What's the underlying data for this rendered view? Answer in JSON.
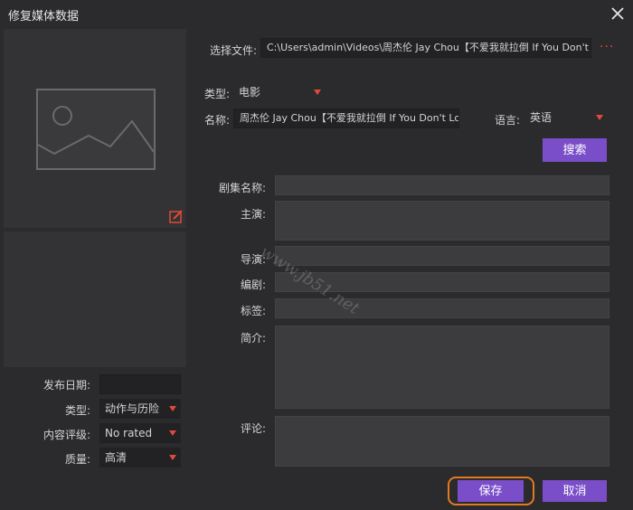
{
  "window": {
    "title": "修复媒体数据",
    "close_icon": "close-icon"
  },
  "poster": {
    "placeholder_icon": "image-placeholder-icon",
    "edit_icon": "edit-icon"
  },
  "file": {
    "label": "选择文件:",
    "value": "C:\\Users\\admin\\Videos\\周杰伦 Jay Chou【不爱我就拉倒 If You Don't Love Me",
    "more_icon": "more-icon",
    "more_label": "···"
  },
  "search": {
    "type_label": "类型:",
    "type_value": "电影",
    "name_label": "名称:",
    "name_value": "周杰伦 Jay Chou【不爱我就拉倒 If You Don't Love Me",
    "language_label": "语言:",
    "language_value": "英语",
    "search_button": "搜索"
  },
  "details": {
    "series_label": "剧集名称:",
    "series_value": "",
    "cast_label": "主演:",
    "cast_value": "",
    "director_label": "导演:",
    "director_value": "",
    "writer_label": "编剧:",
    "writer_value": "",
    "tags_label": "标签:",
    "tags_value": "",
    "synopsis_label": "简介:",
    "synopsis_value": "",
    "comment_label": "评论:",
    "comment_value": ""
  },
  "left_meta": {
    "release_label": "发布日期:",
    "release_value": "",
    "genre_label": "类型:",
    "genre_value": "动作与历险",
    "rating_label": "内容评级:",
    "rating_value": "No rated",
    "quality_label": "质量:",
    "quality_value": "高清"
  },
  "actions": {
    "save": "保存",
    "cancel": "取消"
  },
  "watermark": "www.jb51.net",
  "colors": {
    "accent": "#7a4ec8",
    "arrow": "#e04a3a",
    "focus_ring": "#e07a22"
  }
}
